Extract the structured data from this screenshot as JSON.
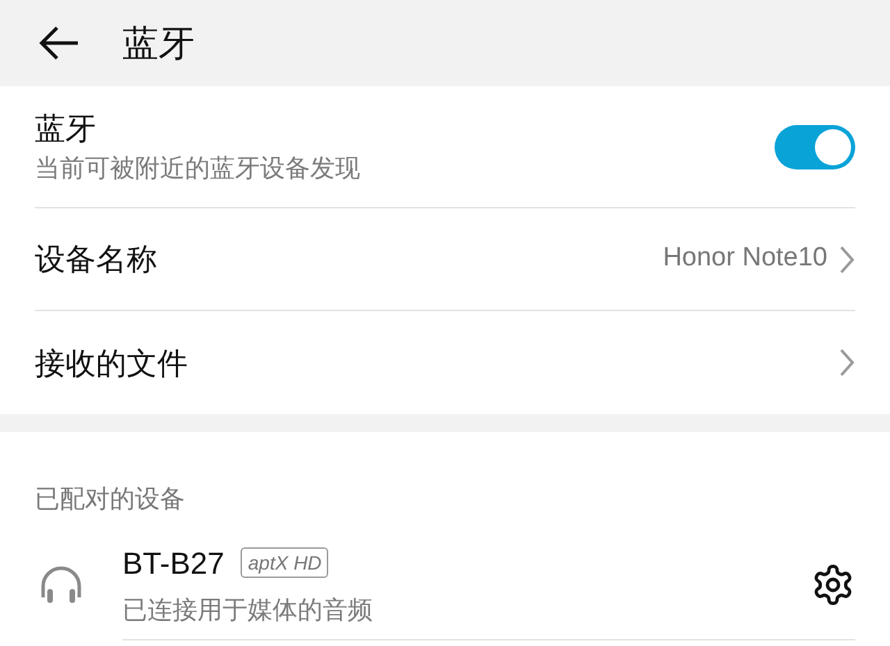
{
  "header": {
    "title": "蓝牙"
  },
  "settings": [
    {
      "kind": "toggle",
      "title": "蓝牙",
      "subtitle": "当前可被附近的蓝牙设备发现",
      "on": true
    },
    {
      "kind": "link",
      "title": "设备名称",
      "value": "Honor Note10"
    },
    {
      "kind": "link",
      "title": "接收的文件"
    }
  ],
  "paired": {
    "heading": "已配对的设备",
    "devices": [
      {
        "name": "BT-B27",
        "badge": "aptX HD",
        "status": "已连接用于媒体的音频"
      }
    ]
  }
}
